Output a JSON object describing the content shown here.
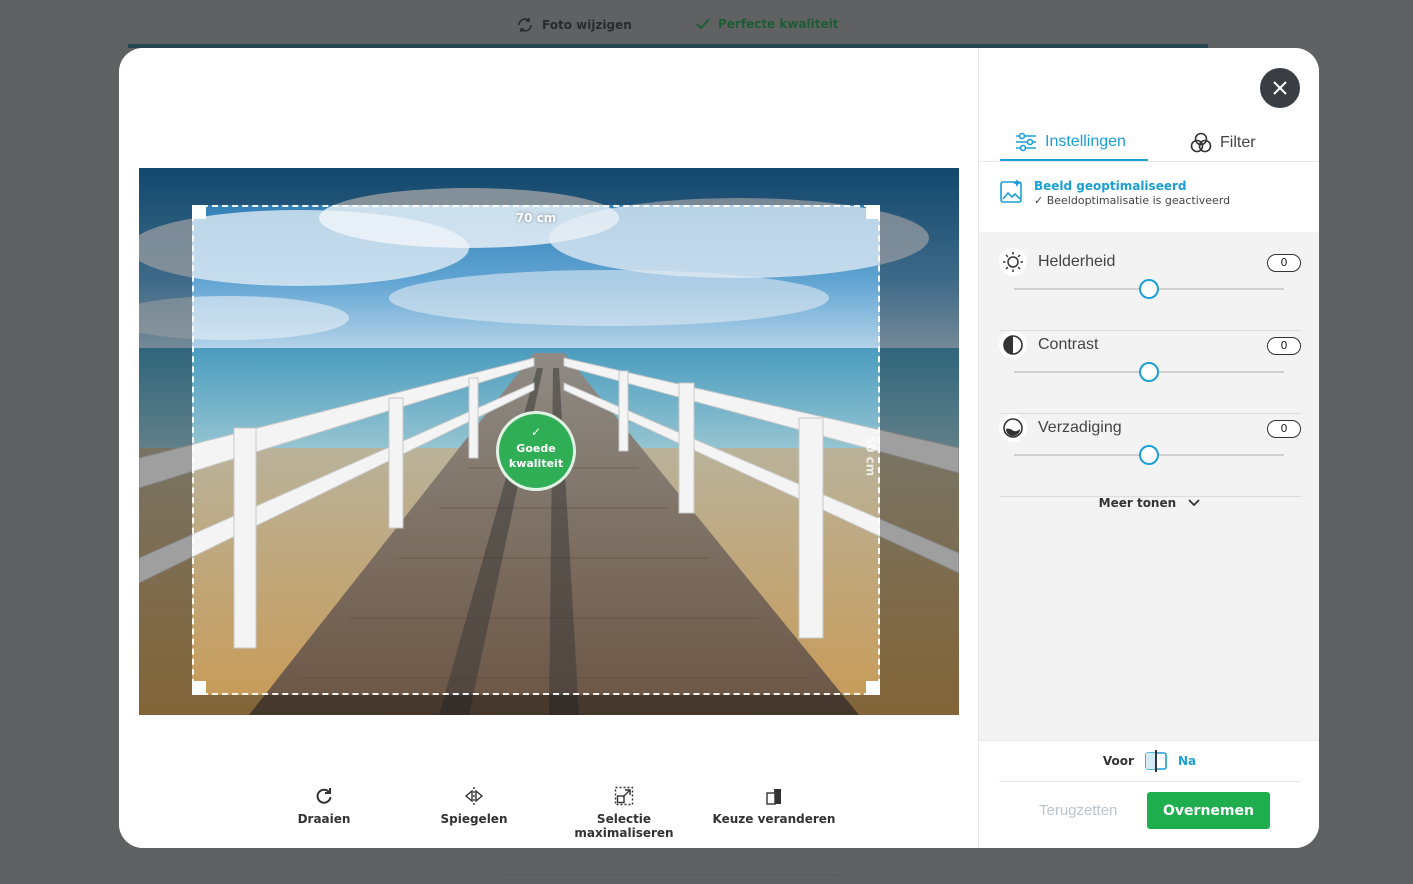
{
  "background": {
    "change_photo": "Foto wijzigen",
    "quality": "Perfecte kwaliteit"
  },
  "photo": {
    "width_label": "70 cm",
    "height_label": "50 cm",
    "quality_badge": "Goede kwaliteit",
    "crop_handles": 4
  },
  "tools": [
    {
      "label": "Draaien",
      "icon": "rotate-icon"
    },
    {
      "label": "Spiegelen",
      "icon": "mirror-icon"
    },
    {
      "label": "Selectie maximaliseren",
      "icon": "maximize-selection-icon"
    },
    {
      "label": "Keuze veranderen",
      "icon": "change-choice-icon"
    }
  ],
  "panel": {
    "tabs": [
      {
        "label": "Instellingen",
        "icon": "sliders-icon",
        "active": true
      },
      {
        "label": "Filter",
        "icon": "filter-icon",
        "active": false
      }
    ],
    "optimized": {
      "title": "Beeld geoptimaliseerd",
      "subtitle": "✓ Beeldoptimalisatie is geactiveerd"
    },
    "sliders": [
      {
        "label": "Helderheid",
        "value": "0",
        "icon": "brightness-icon",
        "position": 0.5
      },
      {
        "label": "Contrast",
        "value": "0",
        "icon": "contrast-icon",
        "position": 0.5
      },
      {
        "label": "Verzadiging",
        "value": "0",
        "icon": "saturation-icon",
        "position": 0.5
      }
    ],
    "more_label": "Meer tonen",
    "compare": {
      "before": "Voor",
      "after": "Na"
    },
    "reset_label": "Terugzetten",
    "apply_label": "Overnemen"
  },
  "colors": {
    "accent": "#1a9fd6",
    "primary_button": "#1fae4d",
    "quality_badge": "#2fae55",
    "overlay": "#5f6163"
  }
}
